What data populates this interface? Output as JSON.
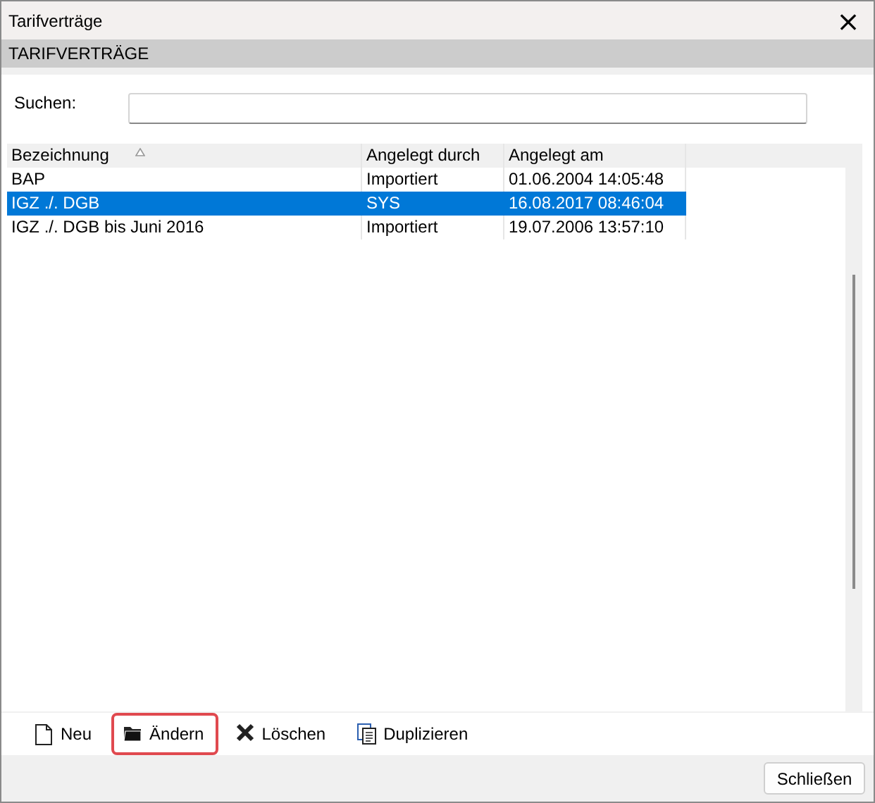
{
  "window": {
    "title": "Tarifverträge",
    "close": "×"
  },
  "section": {
    "title": "TARIFVERTRÄGE"
  },
  "search": {
    "label": "Suchen:"
  },
  "table": {
    "columns": [
      {
        "label": "Bezeichnung",
        "sorted": true
      },
      {
        "label": "Angelegt durch",
        "sorted": false
      },
      {
        "label": "Angelegt am",
        "sorted": false
      }
    ],
    "rows": [
      {
        "cells": [
          "BAP",
          "Importiert",
          "01.06.2004 14:05:48"
        ],
        "selected": false
      },
      {
        "cells": [
          "IGZ ./. DGB",
          "SYS",
          "16.08.2017 08:46:04"
        ],
        "selected": true
      },
      {
        "cells": [
          "IGZ ./. DGB bis Juni 2016",
          "Importiert",
          "19.07.2006 13:57:10"
        ],
        "selected": false
      }
    ]
  },
  "toolbar": [
    {
      "kind": "new",
      "label": "Neu",
      "focused": false
    },
    {
      "kind": "edit",
      "label": "Ändern",
      "focused": true
    },
    {
      "kind": "delete",
      "label": "Löschen",
      "focused": false
    },
    {
      "kind": "duplicate",
      "label": "Duplizieren",
      "focused": false
    }
  ],
  "footer": {
    "close_button": "Schließen"
  }
}
